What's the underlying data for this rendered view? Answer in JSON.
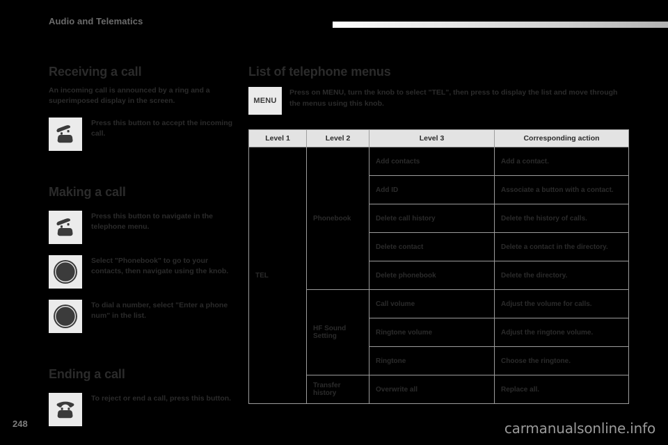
{
  "header": {
    "title": "Audio and Telematics"
  },
  "left_column": {
    "sections": [
      {
        "heading": "Receiving a call",
        "paragraph": "An incoming call is announced by a ring and a superimposed display in the screen.",
        "rows": [
          {
            "icon": "phone-offhook-icon",
            "text": "Press this button to accept the incoming call."
          }
        ]
      },
      {
        "heading": "Making a call",
        "paragraph": "",
        "rows": [
          {
            "icon": "phone-offhook-icon",
            "text": "Press this button to navigate in the telephone menu."
          },
          {
            "icon": "rotary-knob-icon",
            "text": "Select \"Phonebook\" to go to your contacts, then navigate using the knob."
          },
          {
            "icon": "rotary-knob-icon",
            "text": "To dial a number, select \"Enter a phone num\" in the list."
          }
        ]
      },
      {
        "heading": "Ending a call",
        "paragraph": "",
        "rows": [
          {
            "icon": "phone-onhook-icon",
            "text": "To reject or end a call, press this button."
          }
        ]
      }
    ]
  },
  "right_column": {
    "heading": "List of telephone menus",
    "menu_button_label": "MENU",
    "menu_instruction": "Press on MENU, turn the knob to select \"TEL\", then press to display the list and move through the menus using this knob.",
    "table": {
      "headers": [
        "Level 1",
        "Level 2",
        "Level 3",
        "Corresponding action"
      ],
      "level1": "TEL",
      "groups": [
        {
          "level2": "Phonebook",
          "rows": [
            {
              "level3": "Add contacts",
              "action": "Add a contact."
            },
            {
              "level3": "Add ID",
              "action": "Associate a button with a contact."
            },
            {
              "level3": "Delete call history",
              "action": "Delete the history of calls."
            },
            {
              "level3": "Delete contact",
              "action": "Delete a contact in the directory."
            },
            {
              "level3": "Delete phonebook",
              "action": "Delete the directory."
            }
          ]
        },
        {
          "level2": "HF Sound Setting",
          "rows": [
            {
              "level3": "Call volume",
              "action": "Adjust the volume for calls."
            },
            {
              "level3": "Ringtone volume",
              "action": "Adjust the ringtone volume."
            },
            {
              "level3": "Ringtone",
              "action": "Choose the ringtone."
            }
          ]
        },
        {
          "level2": "Transfer history",
          "rows": [
            {
              "level3": "Overwrite all",
              "action": "Replace all."
            }
          ]
        }
      ]
    }
  },
  "footer": {
    "page_number": "248",
    "watermark": "carmanualsonline.info"
  },
  "colors": {
    "background": "#000000",
    "text": "#2b2b2b",
    "icon_box": "#ebebeb",
    "table_header": "#e3e3e3",
    "table_border": "#9d9d9d",
    "header_title": "#6b6b6b",
    "watermark": "#9a9a9a"
  }
}
